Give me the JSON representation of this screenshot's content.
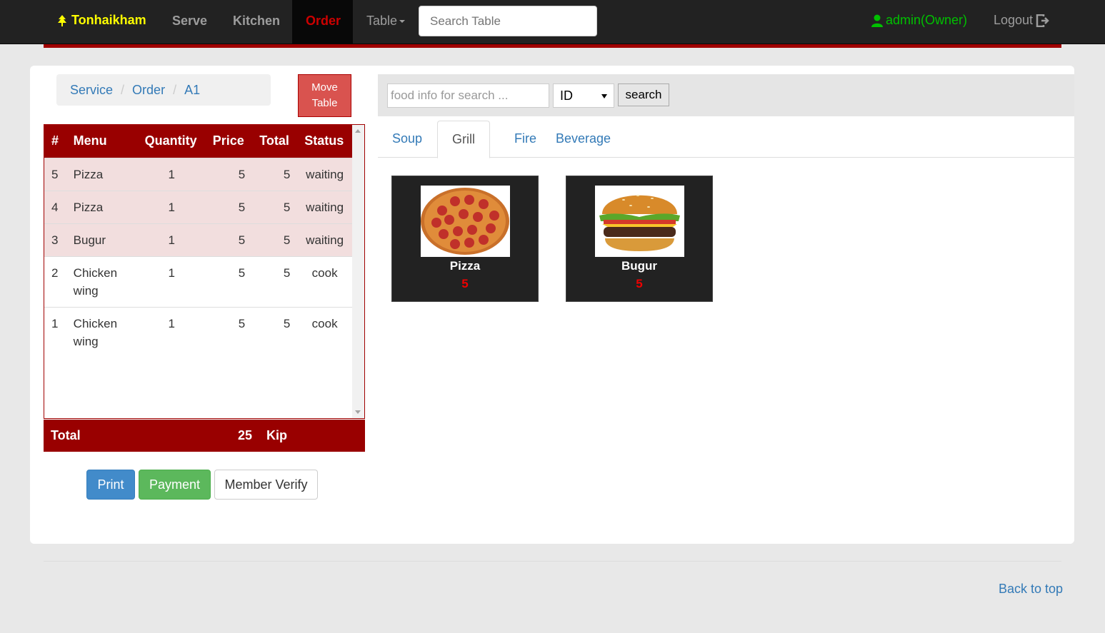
{
  "nav": {
    "brand": "Tonhaikham",
    "items": [
      "Serve",
      "Kitchen",
      "Order"
    ],
    "table_label": "Table",
    "search_placeholder": "Search Table",
    "user": "admin(Owner)",
    "logout": "Logout",
    "active_item": "Order"
  },
  "breadcrumb": [
    "Service",
    "Order",
    "A1"
  ],
  "move_table": "Move Table",
  "order": {
    "headers": [
      "#",
      "Menu",
      "Quantity",
      "Price",
      "Total",
      "Status"
    ],
    "rows": [
      {
        "id": "5",
        "menu": "Pizza",
        "qty": "1",
        "price": "5",
        "total": "5",
        "status": "waiting"
      },
      {
        "id": "4",
        "menu": "Pizza",
        "qty": "1",
        "price": "5",
        "total": "5",
        "status": "waiting"
      },
      {
        "id": "3",
        "menu": "Bugur",
        "qty": "1",
        "price": "5",
        "total": "5",
        "status": "waiting"
      },
      {
        "id": "2",
        "menu": "Chicken wing",
        "qty": "1",
        "price": "5",
        "total": "5",
        "status": "cook"
      },
      {
        "id": "1",
        "menu": "Chicken wing",
        "qty": "1",
        "price": "5",
        "total": "5",
        "status": "cook"
      }
    ],
    "total_label": "Total",
    "total_amount": "25",
    "currency": "Kip"
  },
  "actions": {
    "print": "Print",
    "payment": "Payment",
    "member_verify": "Member Verify"
  },
  "food_search": {
    "placeholder": "food info for search ...",
    "select_value": "ID",
    "button": "search"
  },
  "tabs": [
    "Soup",
    "Grill",
    "Fire",
    "Beverage"
  ],
  "active_tab": "Grill",
  "foods": [
    {
      "name": "Pizza",
      "price": "5"
    },
    {
      "name": "Bugur",
      "price": "5"
    }
  ],
  "footer": {
    "back_to_top": "Back to top"
  },
  "colors": {
    "nav_bg": "#222222",
    "brand": "#ffff00",
    "active_red": "#cc0000",
    "header_red": "#990000",
    "user_green": "#00c000"
  }
}
